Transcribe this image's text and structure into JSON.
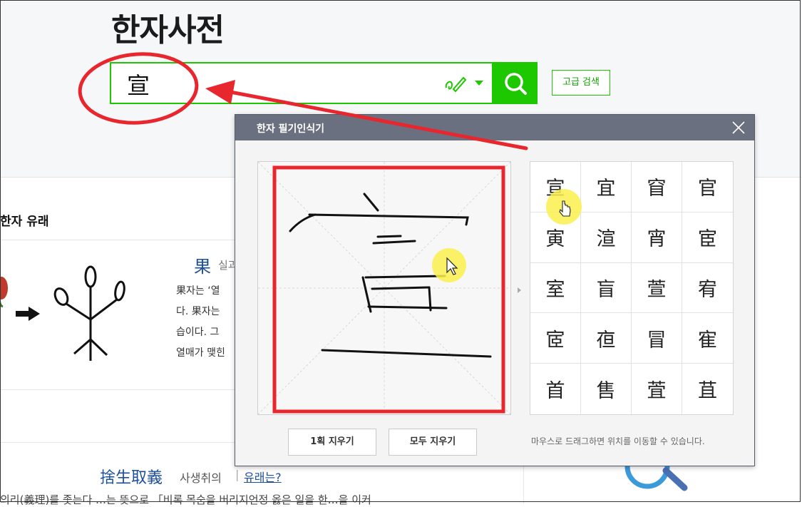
{
  "page": {
    "title": "한자사전"
  },
  "search": {
    "value": "宣",
    "advanced_label": "고급 검색"
  },
  "origin": {
    "section_title": "한자 유래",
    "char": "果",
    "reading": "실과",
    "lines": [
      "果자는 ‘열",
      "다. 果자는",
      "습이다. 그",
      "열매가 맺힌"
    ]
  },
  "idiom": {
    "hanja": "捨生取義",
    "reading": "사생취의",
    "separator": "|",
    "link": "유래는?",
    "desc": "의리(義理)를 좇는다 …는 뜻으로 「비록 목숨을 버리지언정 옳은 일을 한…을 이커"
  },
  "panel": {
    "title": "한자 필기인식기",
    "candidates": [
      "宣",
      "宜",
      "窅",
      "官",
      "寅",
      "渲",
      "宵",
      "宦",
      "室",
      "盲",
      "萱",
      "宥",
      "宧",
      "亱",
      "冒",
      "寉",
      "首",
      "售",
      "萓",
      "苴"
    ],
    "erase_one_label": "1획 지우기",
    "erase_all_label": "모두 지우기",
    "hint": "마우스로 드래그하면 위치를 이동할 수 있습니다."
  },
  "colors": {
    "brand": "#1ec800",
    "annotation": "#e8262d",
    "titlebar": "#6b7080",
    "link": "#1c4e9c"
  }
}
